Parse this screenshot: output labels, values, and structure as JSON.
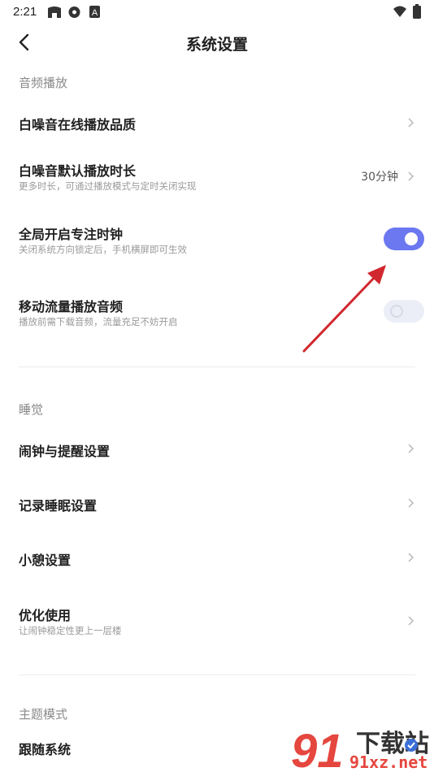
{
  "status_bar": {
    "time": "2:21"
  },
  "header": {
    "title": "系统设置"
  },
  "sections": [
    {
      "label": "音频播放"
    },
    {
      "label": "睡觉"
    },
    {
      "label": "主题模式"
    }
  ],
  "audio": {
    "quality_label": "白噪音在线播放品质",
    "duration_label": "白噪音默认播放时长",
    "duration_sub": "更多时长，可通过播放模式与定时关闭实现",
    "duration_value": "30分钟",
    "clock_label": "全局开启专注时钟",
    "clock_sub": "关闭系统方向锁定后，手机横屏即可生效",
    "clock_on": true,
    "mobile_label": "移动流量播放音频",
    "mobile_sub": "播放前需下载音频，流量充足不妨开启",
    "mobile_on": false
  },
  "sleep": {
    "alarm_label": "闹钟与提醒设置",
    "record_label": "记录睡眠设置",
    "nap_label": "小憩设置",
    "optimize_label": "优化使用",
    "optimize_sub": "让闹钟稳定性更上一层楼"
  },
  "theme": {
    "follow_label": "跟随系统"
  },
  "watermark": {
    "brand": "下载站",
    "url": "91xz.net",
    "logo_digits": "91"
  },
  "colors": {
    "toggle_on": "#6b78f0",
    "arrow": "#d0282e"
  }
}
